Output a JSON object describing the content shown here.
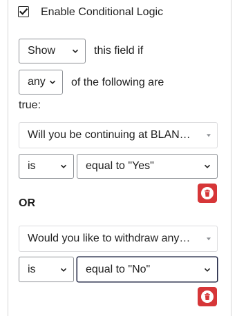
{
  "conditional_logic": {
    "enable_label": "Enable Conditional Logic",
    "enabled": true,
    "action_select": "Show",
    "action_suffix": "this field if",
    "match_select": "any",
    "match_suffix_line1": "of the following are",
    "match_suffix_line2": "true:",
    "separator": "OR",
    "rules": [
      {
        "field": "Will you be continuing at BLAN…",
        "operator": "is",
        "value": "equal to \"Yes\""
      },
      {
        "field": "Would you like to withdraw any…",
        "operator": "is",
        "value": "equal to \"No\""
      }
    ]
  },
  "colors": {
    "delete_button": "#d63638",
    "focus_border": "#1d2340",
    "select_border": "#8c8f94"
  },
  "icons": {
    "checkbox": "checkmark-icon",
    "delete": "trash-icon",
    "dropdown": "chevron-down-icon"
  }
}
